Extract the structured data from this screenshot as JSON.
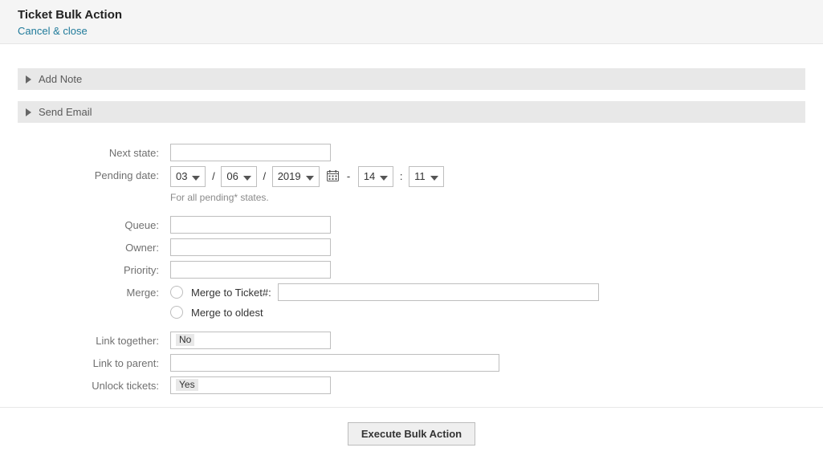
{
  "header": {
    "title": "Ticket Bulk Action",
    "cancel_link": "Cancel & close"
  },
  "panels": {
    "add_note": "Add Note",
    "send_email": "Send Email"
  },
  "labels": {
    "next_state": "Next state:",
    "pending_date": "Pending date:",
    "queue": "Queue:",
    "owner": "Owner:",
    "priority": "Priority:",
    "merge": "Merge:",
    "link_together": "Link together:",
    "link_to_parent": "Link to parent:",
    "unlock_tickets": "Unlock tickets:"
  },
  "pending": {
    "month": "03",
    "day": "06",
    "year": "2019",
    "hour": "14",
    "minute": "11",
    "help": "For all pending* states."
  },
  "merge": {
    "to_ticket_label": "Merge to Ticket#:",
    "to_oldest_label": "Merge to oldest",
    "ticket_value": ""
  },
  "values": {
    "next_state": "",
    "queue": "",
    "owner": "",
    "priority": "",
    "link_together": "No",
    "link_to_parent": "",
    "unlock_tickets": "Yes"
  },
  "footer": {
    "execute": "Execute Bulk Action"
  }
}
